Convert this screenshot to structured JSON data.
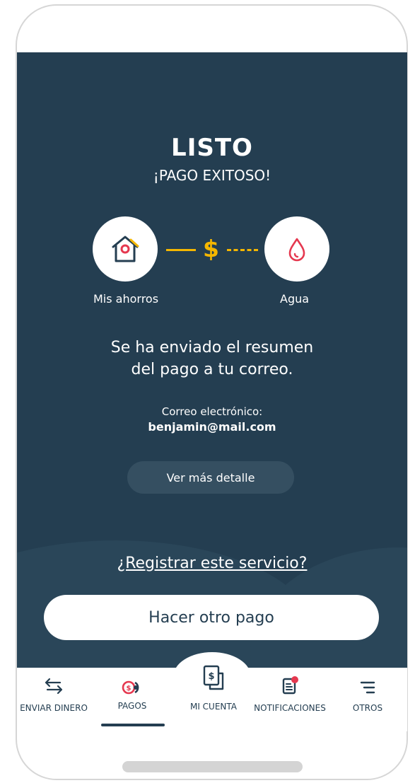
{
  "success": {
    "title": "LISTO",
    "subtitle": "¡PAGO EXITOSO!",
    "from_label": "Mis ahorros",
    "to_label": "Agua",
    "currency_symbol": "$",
    "message_line1": "Se ha enviado el resumen",
    "message_line2": "del pago a tu correo.",
    "email_label": "Correo electrónico:",
    "email_value": "benjamin@mail.com",
    "detail_button": "Ver más detalle",
    "register_link": "¿Registrar este servicio?",
    "primary_button": "Hacer otro pago"
  },
  "tabbar": {
    "items": [
      {
        "label": "ENVIAR DINERO",
        "icon": "transfer-arrows-icon"
      },
      {
        "label": "PAGOS",
        "icon": "coins-icon",
        "active": true
      },
      {
        "label": "MI CUENTA",
        "icon": "receipt-dollar-icon"
      },
      {
        "label": "NOTIFICACIONES",
        "icon": "notification-document-icon"
      },
      {
        "label": "OTROS",
        "icon": "menu-lines-icon"
      }
    ]
  },
  "colors": {
    "background": "#243e51",
    "accent": "#f5b700",
    "alert": "#e5384f",
    "surface": "#ffffff"
  }
}
